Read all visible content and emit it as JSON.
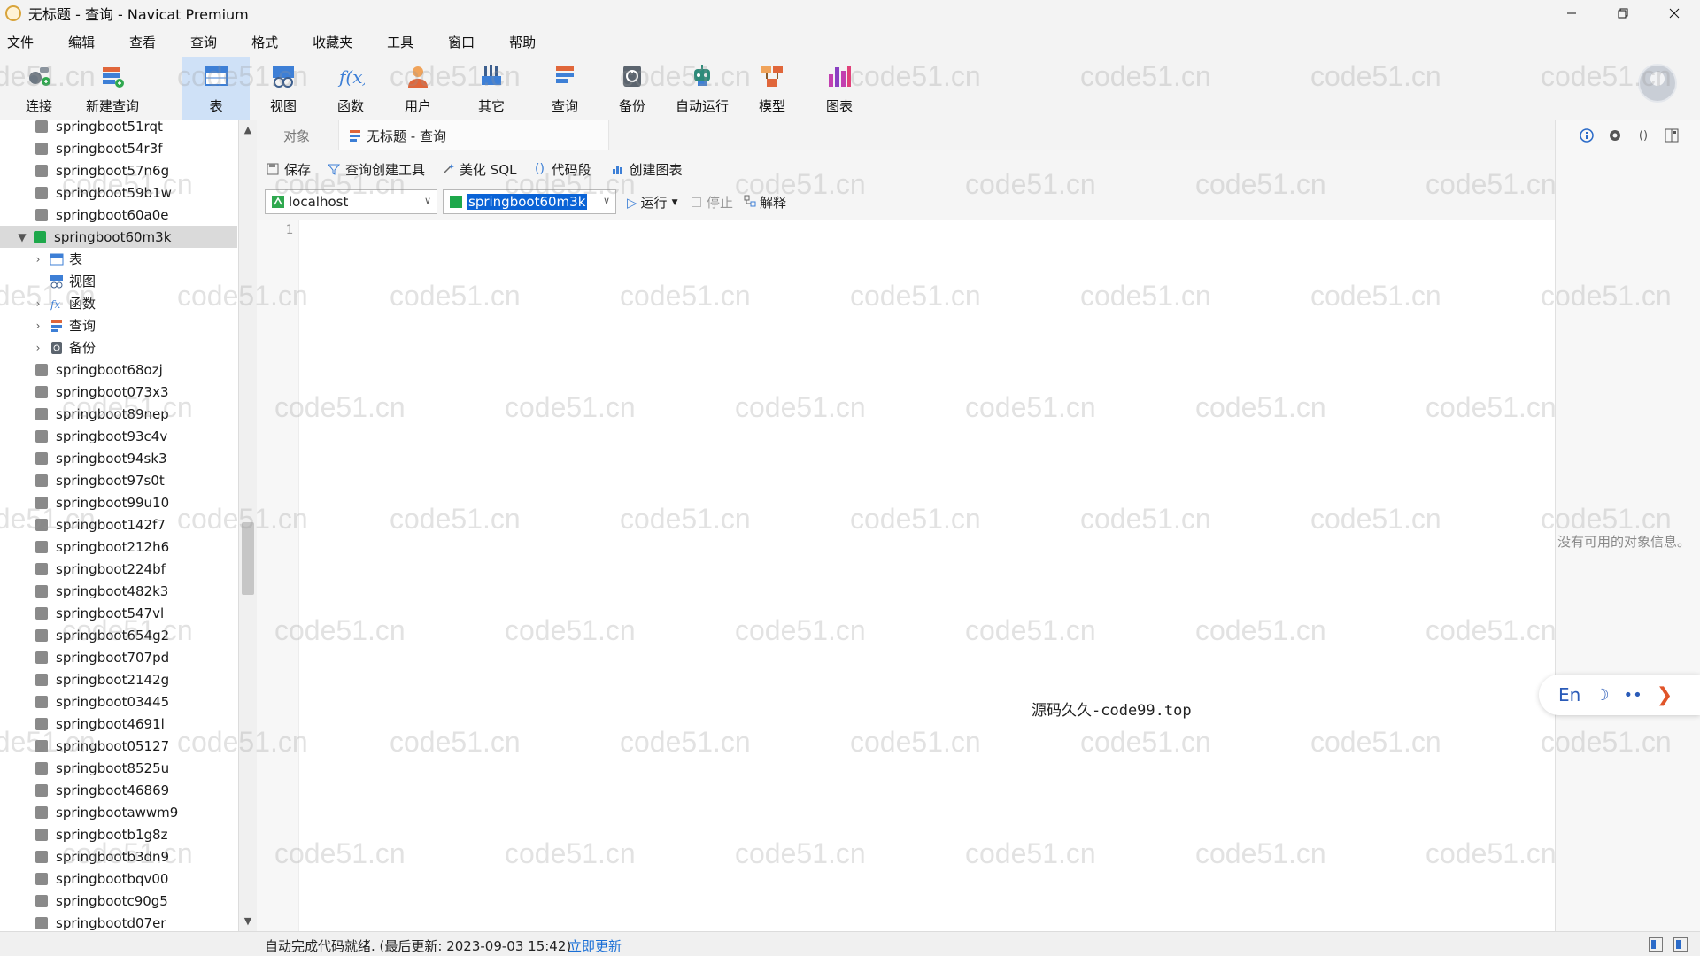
{
  "window": {
    "title": "无标题 - 查询 - Navicat Premium",
    "minimize_icon": "minimize-icon",
    "restore_icon": "restore-icon",
    "close_icon": "close-icon"
  },
  "menu": [
    "文件",
    "编辑",
    "查看",
    "查询",
    "格式",
    "收藏夹",
    "工具",
    "窗口",
    "帮助"
  ],
  "toolbar": {
    "items": [
      {
        "label": "连接",
        "icon": "connect-icon"
      },
      {
        "label": "新建查询",
        "icon": "new-query-icon"
      },
      {
        "label": "表",
        "icon": "table-icon",
        "active": true
      },
      {
        "label": "视图",
        "icon": "view-icon"
      },
      {
        "label": "函数",
        "icon": "function-icon"
      },
      {
        "label": "用户",
        "icon": "user-icon"
      },
      {
        "label": "其它",
        "icon": "other-icon"
      },
      {
        "label": "查询",
        "icon": "query-icon"
      },
      {
        "label": "备份",
        "icon": "backup-icon"
      },
      {
        "label": "自动运行",
        "icon": "auto-run-icon"
      },
      {
        "label": "模型",
        "icon": "model-icon"
      },
      {
        "label": "图表",
        "icon": "chart-icon"
      }
    ]
  },
  "sidebar": {
    "databases_before": [
      "springboot51rqt",
      "springboot54r3f",
      "springboot57n6g",
      "springboot59b1w",
      "springboot60a0e"
    ],
    "selected_db": "springboot60m3k",
    "children": [
      {
        "label": "表",
        "expandable": true
      },
      {
        "label": "视图",
        "expandable": false
      },
      {
        "label": "函数",
        "expandable": true
      },
      {
        "label": "查询",
        "expandable": true
      },
      {
        "label": "备份",
        "expandable": true
      }
    ],
    "databases_after": [
      "springboot68ozj",
      "springboot073x3",
      "springboot89nep",
      "springboot93c4v",
      "springboot94sk3",
      "springboot97s0t",
      "springboot99u10",
      "springboot142f7",
      "springboot212h6",
      "springboot224bf",
      "springboot482k3",
      "springboot547vl",
      "springboot654g2",
      "springboot707pd",
      "springboot2142g",
      "springboot03445",
      "springboot4691l",
      "springboot05127",
      "springboot8525u",
      "springboot46869",
      "springbootawwm9",
      "springbootb1g8z",
      "springbootb3dn9",
      "springbootbqv00",
      "springbootc90g5",
      "springbootd07er"
    ]
  },
  "tabs": {
    "objects": "对象",
    "query": "无标题 - 查询"
  },
  "query_toolbar": {
    "save": "保存",
    "builder": "查询创建工具",
    "beautify": "美化 SQL",
    "snippet": "代码段",
    "create_chart": "创建图表"
  },
  "connection": {
    "server": "localhost",
    "database": "springboot60m3k",
    "run": "运行",
    "stop": "停止",
    "explain": "解释"
  },
  "editor": {
    "line_number": "1",
    "center_text": "源码久久-code99.top"
  },
  "right_panel": {
    "empty_text": "没有可用的对象信息。"
  },
  "status": {
    "text": "自动完成代码就绪. (最后更新: 2023-09-03 15:42)",
    "link": "立即更新"
  },
  "ime": {
    "lang": "En",
    "moon": "☽",
    "quotes": "••",
    "arrow": "❯"
  },
  "watermark": "code51.cn"
}
